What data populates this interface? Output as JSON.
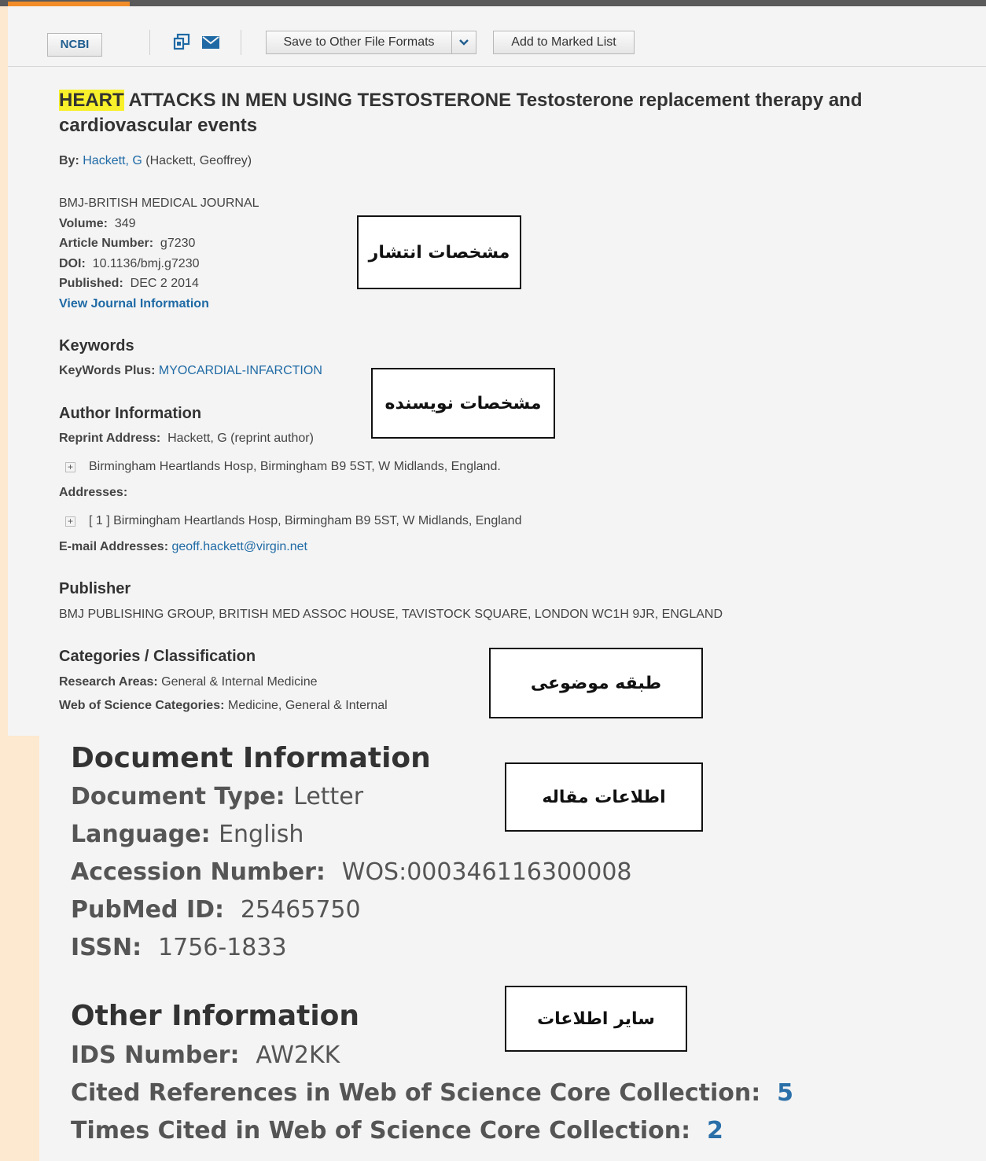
{
  "toolbar": {
    "ncbi_label": "NCBI",
    "save_label": "Save to Other File Formats",
    "marked_label": "Add to Marked List"
  },
  "record": {
    "title_highlight": "HEART",
    "title_rest": " ATTACKS IN MEN USING TESTOSTERONE Testosterone replacement therapy and cardiovascular events",
    "by_label": "By:",
    "author_link": "Hackett, G",
    "author_full": "(Hackett, Geoffrey)",
    "journal": "BMJ-BRITISH MEDICAL JOURNAL",
    "volume_label": "Volume:",
    "volume": "349",
    "article_label": "Article Number:",
    "article": "g7230",
    "doi_label": "DOI:",
    "doi": "10.1136/bmj.g7230",
    "published_label": "Published:",
    "published": "DEC 2 2014",
    "view_journal": "View Journal Information"
  },
  "keywords": {
    "heading": "Keywords",
    "plus_label": "KeyWords Plus:",
    "plus_value": "MYOCARDIAL-INFARCTION"
  },
  "author_info": {
    "heading": "Author Information",
    "reprint_label": "Reprint Address:",
    "reprint_value": "Hackett, G (reprint author)",
    "reprint_address": "Birmingham Heartlands Hosp, Birmingham B9 5ST, W Midlands, England.",
    "addresses_label": "Addresses:",
    "address_1": "[ 1 ] Birmingham Heartlands Hosp, Birmingham B9 5ST, W Midlands, England",
    "email_label": "E-mail Addresses:",
    "email": "geoff.hackett@virgin.net"
  },
  "publisher": {
    "heading": "Publisher",
    "value": "BMJ PUBLISHING GROUP, BRITISH MED ASSOC HOUSE, TAVISTOCK SQUARE, LONDON WC1H 9JR, ENGLAND"
  },
  "categories": {
    "heading": "Categories / Classification",
    "research_label": "Research Areas:",
    "research_value": "General & Internal Medicine",
    "wos_label": "Web of Science Categories:",
    "wos_value": "Medicine, General & Internal"
  },
  "document": {
    "heading": "Document Information",
    "type_label": "Document Type:",
    "type_value": "Letter",
    "language_label": "Language:",
    "language_value": "English",
    "accession_label": "Accession Number:",
    "accession_value": "WOS:000346116300008",
    "pubmed_label": "PubMed ID:",
    "pubmed_value": "25465750",
    "issn_label": "ISSN:",
    "issn_value": "1756-1833"
  },
  "other": {
    "heading": "Other Information",
    "ids_label": "IDS Number:",
    "ids_value": "AW2KK",
    "cited_label": "Cited References in Web of Science Core Collection:",
    "cited_value": "5",
    "times_label": "Times Cited in Web of Science Core Collection:",
    "times_value": "2"
  },
  "annotations": {
    "publication": "مشخصات انتشار",
    "author": "مشخصات نویسنده",
    "subject": "طبقه موضوعی",
    "article_info": "اطلاعات مقاله",
    "other_info": "سایر اطلاعات"
  },
  "icons": {
    "print": "print-icon",
    "email": "email-icon",
    "dropdown": "chevron-down-icon",
    "expand": "plus-icon"
  },
  "colors": {
    "accent": "#f28c28",
    "link": "#1f6aa5",
    "highlight": "#f8f02a",
    "side": "#fde9cf"
  }
}
